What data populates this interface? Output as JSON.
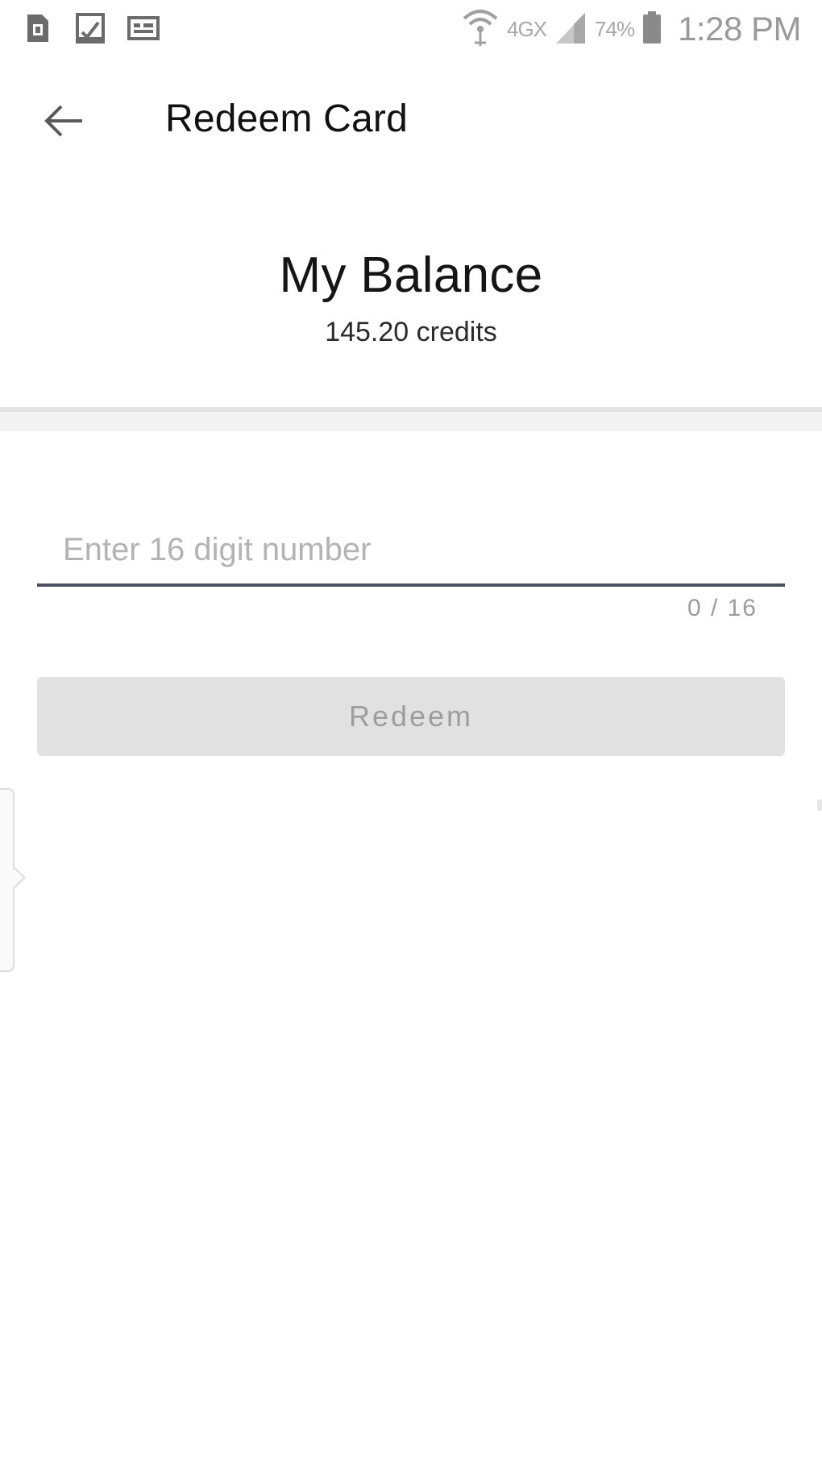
{
  "status_bar": {
    "network_label": "4GX",
    "battery_percent": "74%",
    "time": "1:28 PM",
    "icons": [
      "sim-card-icon",
      "download-done-icon",
      "message-icon",
      "wifi-icon",
      "signal-icon",
      "battery-icon"
    ]
  },
  "app_bar": {
    "title": "Redeem Card",
    "back_icon": "arrow-left-icon"
  },
  "balance": {
    "title": "My Balance",
    "amount": "145.20 credits"
  },
  "form": {
    "input_placeholder": "Enter 16 digit number",
    "input_value": "",
    "counter": "0 / 16",
    "redeem_label": "Redeem"
  },
  "colors": {
    "underline": "#4a5263",
    "button_bg": "#e1e1e1",
    "button_text": "#9d9d9d"
  }
}
